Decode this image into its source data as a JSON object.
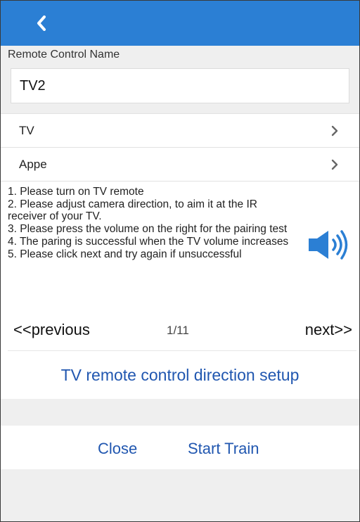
{
  "header": {
    "back_icon": "chevron-left-icon",
    "bar_color": "#2b7fd4"
  },
  "form": {
    "name_label": "Remote Control Name",
    "name_value": "TV2",
    "rows": [
      {
        "label": "TV"
      },
      {
        "label": "Appe"
      }
    ]
  },
  "instructions": [
    "1. Please turn on TV remote",
    "2. Please adjust camera direction, to aim it at the IR receiver of your TV.",
    "3. Please press the volume on the right for the pairing test",
    "4. The paring is successful when the TV volume increases",
    "5. Please click next and try again if unsuccessful"
  ],
  "speaker": {
    "icon": "speaker-volume-icon",
    "color": "#2b7fd4"
  },
  "pager": {
    "previous": "<<previous",
    "indicator": "1/11",
    "next": "next>>"
  },
  "setup_title": "TV remote control direction setup",
  "actions": {
    "close": "Close",
    "start": "Start Train",
    "color": "#2157b0"
  }
}
